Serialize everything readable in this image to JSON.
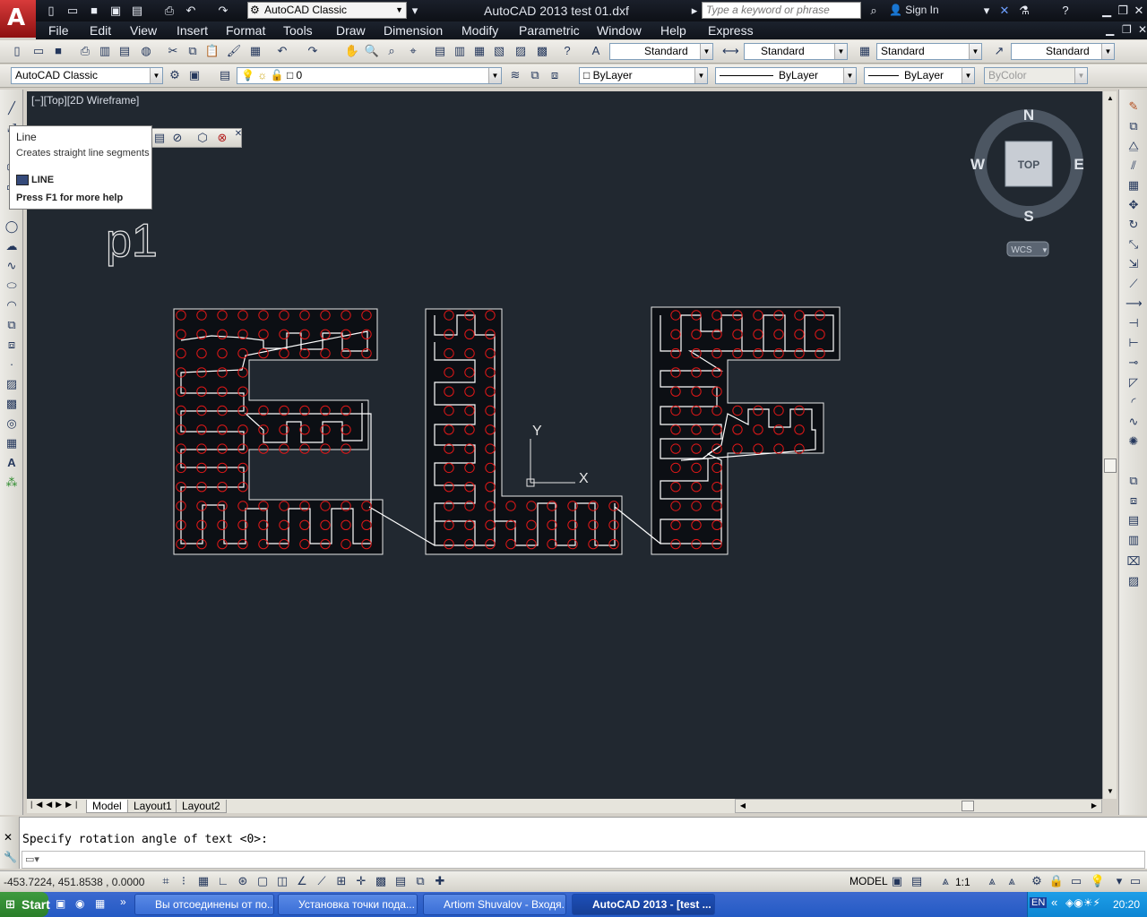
{
  "window": {
    "title": "AutoCAD 2013    test 01.dxf",
    "workspace": "AutoCAD Classic",
    "search_placeholder": "Type a keyword or phrase",
    "sign_in": "Sign In",
    "logo_icon": "autocad-logo-icon"
  },
  "menu": [
    "File",
    "Edit",
    "View",
    "Insert",
    "Format",
    "Tools",
    "Draw",
    "Dimension",
    "Modify",
    "Parametric",
    "Window",
    "Help",
    "Express"
  ],
  "styles_toolbar": {
    "text_style": "Standard",
    "dim_style": "Standard",
    "table_style": "Standard",
    "multileader_style": "Standard"
  },
  "layers_toolbar": {
    "workspace": "AutoCAD Classic",
    "layer": "0",
    "color": "ByLayer",
    "linetype": "ByLayer",
    "lineweight": "ByLayer",
    "plotstyle": "ByColor"
  },
  "viewport": {
    "label": "[−][Top][2D Wireframe]",
    "viewcube_face": "TOP",
    "compass": {
      "n": "N",
      "s": "S",
      "e": "E",
      "w": "W"
    },
    "ucs_menu": "WCS",
    "drawing_text": "p1",
    "ucs_x": "X",
    "ucs_y": "Y"
  },
  "tooltip": {
    "title": "Line",
    "description": "Creates straight line segments",
    "command": "LINE",
    "help": "Press F1 for more help"
  },
  "layout_tabs": [
    "Model",
    "Layout1",
    "Layout2"
  ],
  "command": {
    "history": "Specify rotation angle of text <0>:",
    "input": ""
  },
  "status": {
    "coordinates": "-453.7224, 451.8538 , 0.0000",
    "model": "MODEL",
    "annotation_scale": "1:1"
  },
  "taskbar": {
    "start": "Start",
    "tasks": [
      {
        "label": "Вы отсоединены от по...",
        "active": false
      },
      {
        "label": "Установка точки пода...",
        "active": false
      },
      {
        "label": "Artiom Shuvalov - Входя...",
        "active": false
      },
      {
        "label": "AutoCAD 2013 - [test ...",
        "active": true
      }
    ],
    "language": "EN",
    "clock": "20:20"
  },
  "colors": {
    "drawing_bg": "#212830",
    "hole_circle": "#e01818",
    "path_line": "#ffffff",
    "letter_fill": "#0c0f14"
  }
}
